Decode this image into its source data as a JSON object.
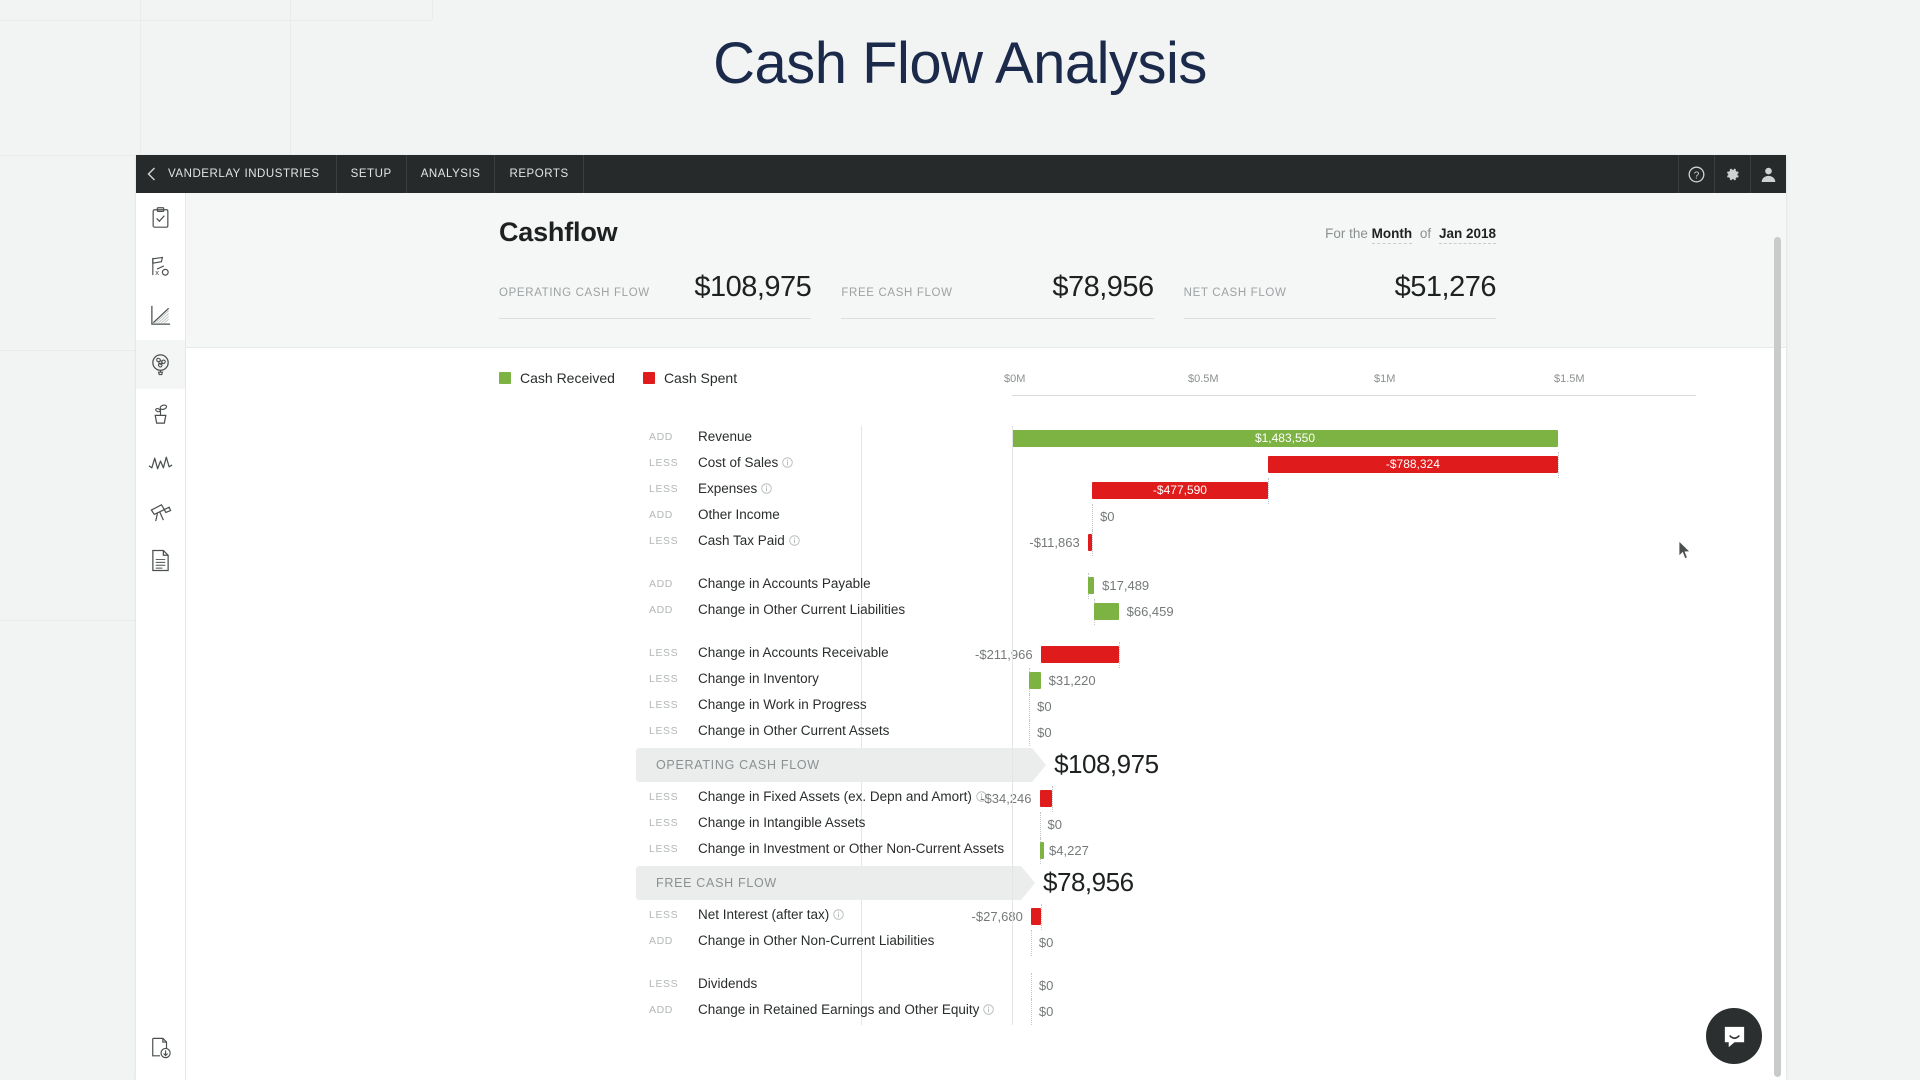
{
  "page": {
    "title": "Cash Flow Analysis",
    "title_color": "#1b2a4a"
  },
  "topbar": {
    "back_icon": "chevron-left-icon",
    "brand": "VANDERLAY INDUSTRIES",
    "items": [
      {
        "label": "SETUP"
      },
      {
        "label": "ANALYSIS"
      },
      {
        "label": "REPORTS"
      }
    ],
    "icons": [
      {
        "name": "help-icon"
      },
      {
        "name": "gear-icon"
      },
      {
        "name": "user-icon"
      }
    ]
  },
  "sidebar": {
    "items": [
      {
        "name": "clipboard-check-icon",
        "active": false
      },
      {
        "name": "scorecard-icon",
        "active": false
      },
      {
        "name": "chart-icon",
        "active": false
      },
      {
        "name": "fan-icon",
        "active": true
      },
      {
        "name": "plant-icon",
        "active": false
      },
      {
        "name": "pulse-icon",
        "active": false
      },
      {
        "name": "telescope-icon",
        "active": false
      },
      {
        "name": "document-icon",
        "active": false
      }
    ],
    "bottom_item": {
      "name": "document-download-icon"
    }
  },
  "header": {
    "title": "Cashflow",
    "period_prefix": "For the",
    "period_unit": "Month",
    "period_of": "of",
    "period_value": "Jan 2018"
  },
  "kpis": [
    {
      "label": "OPERATING CASH FLOW",
      "value": "$108,975"
    },
    {
      "label": "FREE CASH FLOW",
      "value": "$78,956"
    },
    {
      "label": "NET CASH FLOW",
      "value": "$51,276"
    }
  ],
  "legend": [
    {
      "label": "Cash Received",
      "color": "#7cb342"
    },
    {
      "label": "Cash Spent",
      "color": "#e01b1b"
    }
  ],
  "chart_data": {
    "type": "bar",
    "title": "Cashflow",
    "subtitle": "For the Month of Jan 2018",
    "xlabel": "",
    "ylabel": "",
    "xlim": [
      0,
      1600000
    ],
    "grid": false,
    "legend_position": "top-left",
    "axis_ticks": [
      {
        "label": "$0M",
        "value": 0
      },
      {
        "label": "$0.5M",
        "value": 500000
      },
      {
        "label": "$1M",
        "value": 1000000
      },
      {
        "label": "$1.5M",
        "value": 1500000
      }
    ],
    "colors": {
      "received": "#7cb342",
      "spent": "#e01b1b"
    },
    "rows": [
      {
        "op": "ADD",
        "label": "Revenue",
        "value": 1483550,
        "display": "$1,483,550",
        "sign": "positive",
        "info": false,
        "start": 0,
        "end": 1483550
      },
      {
        "op": "LESS",
        "label": "Cost of Sales",
        "value": -788324,
        "display": "-$788,324",
        "sign": "negative",
        "info": true,
        "start": 695226,
        "end": 1483550
      },
      {
        "op": "LESS",
        "label": "Expenses",
        "value": -477590,
        "display": "-$477,590",
        "sign": "negative",
        "info": true,
        "start": 217636,
        "end": 695226
      },
      {
        "op": "ADD",
        "label": "Other Income",
        "value": 0,
        "display": "$0",
        "sign": "zero",
        "info": false,
        "start": 217636,
        "end": 217636
      },
      {
        "op": "LESS",
        "label": "Cash Tax Paid",
        "value": -11863,
        "display": "-$11,863",
        "sign": "negative",
        "info": true,
        "start": 205773,
        "end": 217636
      },
      {
        "spacer": true
      },
      {
        "op": "ADD",
        "label": "Change in Accounts Payable",
        "value": 17489,
        "display": "$17,489",
        "sign": "positive",
        "info": false,
        "start": 205773,
        "end": 223262
      },
      {
        "op": "ADD",
        "label": "Change in Other Current Liabilities",
        "value": 66459,
        "display": "$66,459",
        "sign": "positive",
        "info": false,
        "start": 223262,
        "end": 289721
      },
      {
        "spacer": true
      },
      {
        "op": "LESS",
        "label": "Change in Accounts Receivable",
        "value": -211966,
        "display": "-$211,966",
        "sign": "negative",
        "info": false,
        "start": 77755,
        "end": 289721
      },
      {
        "op": "LESS",
        "label": "Change in Inventory",
        "value": 31220,
        "display": "$31,220",
        "sign": "positive",
        "info": false,
        "start": 46535,
        "end": 77755
      },
      {
        "op": "LESS",
        "label": "Change in Work in Progress",
        "value": 0,
        "display": "$0",
        "sign": "zero",
        "info": false,
        "start": 46535,
        "end": 46535
      },
      {
        "op": "LESS",
        "label": "Change in Other Current Assets",
        "value": 0,
        "display": "$0",
        "sign": "zero",
        "info": false,
        "start": 46535,
        "end": 46535
      }
    ],
    "subtotal_operating": {
      "label": "OPERATING CASH FLOW",
      "display": "$108,975",
      "value": 108975
    },
    "rows2": [
      {
        "op": "LESS",
        "label": "Change in Fixed Assets (ex. Depn and Amort)",
        "value": -34246,
        "display": "-$34,246",
        "sign": "negative",
        "info": true,
        "start": 74729,
        "end": 108975
      },
      {
        "op": "LESS",
        "label": "Change in Intangible Assets",
        "value": 0,
        "display": "$0",
        "sign": "zero",
        "info": false,
        "start": 74729,
        "end": 74729
      },
      {
        "op": "LESS",
        "label": "Change in Investment or Other Non-Current Assets",
        "value": 4227,
        "display": "$4,227",
        "sign": "positive",
        "info": false,
        "start": 74729,
        "end": 78956
      }
    ],
    "subtotal_free": {
      "label": "FREE CASH FLOW",
      "display": "$78,956",
      "value": 78956
    },
    "rows3": [
      {
        "op": "LESS",
        "label": "Net Interest (after tax)",
        "value": -27680,
        "display": "-$27,680",
        "sign": "negative",
        "info": true,
        "start": 51276,
        "end": 78956
      },
      {
        "op": "ADD",
        "label": "Change in Other Non-Current Liabilities",
        "value": 0,
        "display": "$0",
        "sign": "zero",
        "info": false,
        "start": 51276,
        "end": 51276
      },
      {
        "spacer": true
      },
      {
        "op": "LESS",
        "label": "Dividends",
        "value": 0,
        "display": "$0",
        "sign": "zero",
        "info": false,
        "start": 51276,
        "end": 51276
      },
      {
        "op": "ADD",
        "label": "Change in Retained Earnings and Other Equity",
        "value": 0,
        "display": "$0",
        "sign": "zero",
        "info": true,
        "start": 51276,
        "end": 51276
      }
    ]
  }
}
